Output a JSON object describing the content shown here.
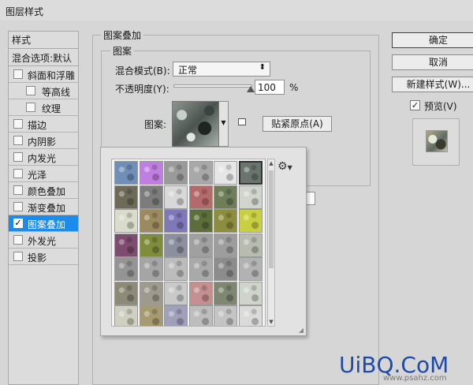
{
  "window": {
    "title": "图层样式"
  },
  "sidebar": {
    "header": "样式",
    "blend_options": "混合选项:默认",
    "items": [
      {
        "label": "斜面和浮雕",
        "checked": false,
        "indent": 0,
        "selected": false
      },
      {
        "label": "等高线",
        "checked": false,
        "indent": 1,
        "selected": false
      },
      {
        "label": "纹理",
        "checked": false,
        "indent": 1,
        "selected": false
      },
      {
        "label": "描边",
        "checked": false,
        "indent": 0,
        "selected": false
      },
      {
        "label": "内阴影",
        "checked": false,
        "indent": 0,
        "selected": false
      },
      {
        "label": "内发光",
        "checked": false,
        "indent": 0,
        "selected": false
      },
      {
        "label": "光泽",
        "checked": false,
        "indent": 0,
        "selected": false
      },
      {
        "label": "颜色叠加",
        "checked": false,
        "indent": 0,
        "selected": false
      },
      {
        "label": "渐变叠加",
        "checked": false,
        "indent": 0,
        "selected": false
      },
      {
        "label": "图案叠加",
        "checked": true,
        "indent": 0,
        "selected": true
      },
      {
        "label": "外发光",
        "checked": false,
        "indent": 0,
        "selected": false
      },
      {
        "label": "投影",
        "checked": false,
        "indent": 0,
        "selected": false
      }
    ]
  },
  "main": {
    "group_title": "图案叠加",
    "inner_title": "图案",
    "blend_mode_label": "混合模式(B):",
    "blend_mode_value": "正常",
    "opacity_label": "不透明度(Y):",
    "opacity_value": "100",
    "opacity_unit": "%",
    "opacity_level": 1.0,
    "pattern_label": "图案:",
    "snap_button": "贴紧原点(A)"
  },
  "picker": {
    "gear_icon": "gear-icon",
    "swatch_colors": [
      "#6f8fb8",
      "#c07fe0",
      "#9a9a9a",
      "#a8a8a8",
      "#e6e6e6",
      "#6b7570",
      "#6d6b58",
      "#7c7c7c",
      "#d8d8d8",
      "#b56a6a",
      "#6e7e58",
      "#d0d4cc",
      "#d9dccb",
      "#9a8a5e",
      "#7f78b8",
      "#5c6e3a",
      "#8d8d3e",
      "#c9d040",
      "#7d4c6e",
      "#7f8c3a",
      "#8b8f9e",
      "#a0a0a0",
      "#9d9d9d",
      "#b8bcae",
      "#949494",
      "#a5a5a5",
      "#bcbcbc",
      "#a9a9a9",
      "#8c8c8c",
      "#b2b2b2",
      "#8d8a78",
      "#9e9a8e",
      "#c9c9c9",
      "#c48f8f",
      "#7f8773",
      "#cfd4cb",
      "#cfd0c0",
      "#a69a70",
      "#a1a0ba",
      "#bdbdbd",
      "#c4c4c4",
      "#dadada"
    ],
    "selected_index": 5
  },
  "right": {
    "ok_button": "确定",
    "cancel_button": "取消",
    "new_style_button": "新建样式(W)...",
    "preview_label": "预览(V)",
    "preview_checked": true
  },
  "watermark": {
    "text": "UiBQ.CoM",
    "sub": "www.psahz.com"
  }
}
